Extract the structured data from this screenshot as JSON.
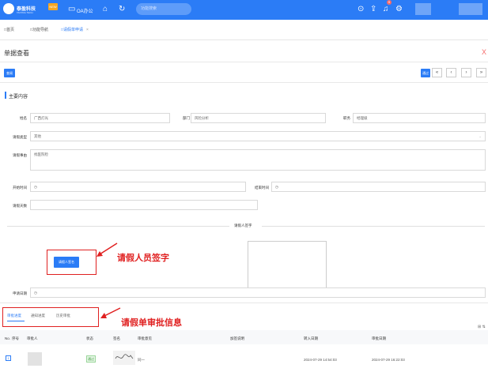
{
  "topbar": {
    "logo_text": "泰盈科技",
    "logo_sub": "TAIYING TECH",
    "new_badge": "NEW",
    "oa_label": "OA办公",
    "search_placeholder": "功能搜索",
    "notification_count": "9"
  },
  "tabs": [
    {
      "label": "首页"
    },
    {
      "label": "功能导航"
    },
    {
      "label": "请假单申请",
      "active": true,
      "close": "×"
    }
  ],
  "page": {
    "title": "单据查看",
    "close_label": "X",
    "view_button": "查阅",
    "pass_button": "通过",
    "pager": [
      "«",
      "‹",
      "›",
      "»"
    ]
  },
  "section": {
    "title": "主要内容"
  },
  "form": {
    "name_label": "姓名",
    "name_value": "广西灯光",
    "dept_label": "部门",
    "dept_value": "风险分析",
    "post_label": "职务",
    "post_value": "经理级",
    "type_label": "请假类型",
    "type_value": "其他",
    "reason_label": "请假事由",
    "reason_value": "找医院检",
    "start_label": "开始时间",
    "start_value": "",
    "end_label": "结束时间",
    "end_value": "",
    "days_label": "请假天数",
    "days_value": "",
    "date_label": "申请日期",
    "date_value": ""
  },
  "signature": {
    "title": "请假人签字",
    "button": "请假人签名"
  },
  "annotations": {
    "sign": "请假人员签字",
    "approval": "请假单审批信息"
  },
  "approval_tabs": [
    {
      "label": "审批进度",
      "active": true
    },
    {
      "label": "通知进度"
    },
    {
      "label": "历史审批"
    }
  ],
  "table": {
    "headers": [
      "No.",
      "序号",
      "审批人",
      "状态",
      "签名",
      "审批意见",
      "加签说明",
      "转入日期",
      "审批日期"
    ],
    "rows": [
      {
        "no": "1",
        "status": "通过",
        "opinion": "同一",
        "in_date": "2024-07-29 14:54:03",
        "approve_date": "2024-07-29 16:22:03"
      }
    ]
  },
  "colors": {
    "accent": "#2b7cf6",
    "annotation": "#e02020",
    "success": "#3a9a3a"
  }
}
